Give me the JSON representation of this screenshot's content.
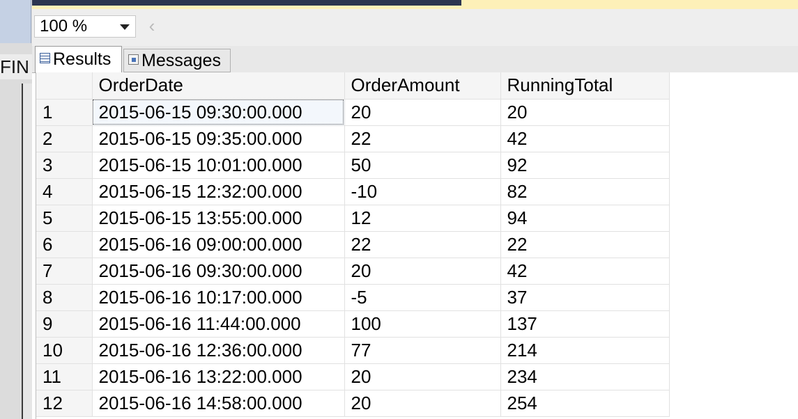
{
  "left_pane": {
    "partial_text": "FIN"
  },
  "toolbar": {
    "zoom_value": "100 %",
    "scroll_left_glyph": "‹"
  },
  "tabs": [
    {
      "label": "Results",
      "icon": "results-grid-icon",
      "active": true
    },
    {
      "label": "Messages",
      "icon": "messages-icon",
      "active": false
    }
  ],
  "results": {
    "columns": [
      "",
      "OrderDate",
      "OrderAmount",
      "RunningTotal"
    ],
    "rows": [
      [
        "1",
        "2015-06-15 09:30:00.000",
        "20",
        "20"
      ],
      [
        "2",
        "2015-06-15 09:35:00.000",
        "22",
        "42"
      ],
      [
        "3",
        "2015-06-15 10:01:00.000",
        "50",
        "92"
      ],
      [
        "4",
        "2015-06-15 12:32:00.000",
        "-10",
        "82"
      ],
      [
        "5",
        "2015-06-15 13:55:00.000",
        "12",
        "94"
      ],
      [
        "6",
        "2015-06-16 09:00:00.000",
        "22",
        "22"
      ],
      [
        "7",
        "2015-06-16 09:30:00.000",
        "20",
        "42"
      ],
      [
        "8",
        "2015-06-16 10:17:00.000",
        "-5",
        "37"
      ],
      [
        "9",
        "2015-06-16 11:44:00.000",
        "100",
        "137"
      ],
      [
        "10",
        "2015-06-16 12:36:00.000",
        "77",
        "214"
      ],
      [
        "11",
        "2015-06-16 13:22:00.000",
        "20",
        "234"
      ],
      [
        "12",
        "2015-06-16 14:58:00.000",
        "20",
        "254"
      ]
    ]
  },
  "colors": {
    "accent_yellow": "#fdf0b8",
    "dark_strip": "#2c3550",
    "selection_outline": "#555555"
  }
}
